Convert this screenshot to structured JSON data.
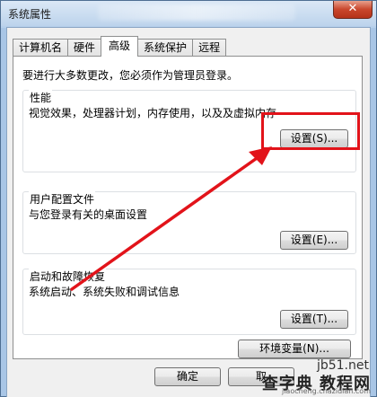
{
  "window": {
    "title": "系统属性",
    "close_label": "✕"
  },
  "tabs": [
    {
      "label": "计算机名",
      "active": false
    },
    {
      "label": "硬件",
      "active": false
    },
    {
      "label": "高级",
      "active": true
    },
    {
      "label": "系统保护",
      "active": false
    },
    {
      "label": "远程",
      "active": false
    }
  ],
  "panel": {
    "notice": "要进行大多数更改，您必须作为管理员登录。",
    "performance": {
      "title": "性能",
      "description": "视觉效果，处理器计划，内存使用，以及及虚拟内存",
      "button": "设置(S)..."
    },
    "user_profile": {
      "title": "用户配置文件",
      "description": "与您登录有关的桌面设置",
      "button": "设置(E)..."
    },
    "startup_recovery": {
      "title": "启动和故障恢复",
      "description": "系统启动、系统失败和调试信息",
      "button": "设置(T)..."
    },
    "env_button": "环境变量(N)..."
  },
  "footer": {
    "ok_button": "确定",
    "cancel_button": "取"
  },
  "watermark": {
    "site": "jb51.net",
    "big": "查字典 教程网",
    "url": "jiaocheng.chazidian.com"
  },
  "colors": {
    "highlight": "#e2131a",
    "arrow": "#e2131a"
  }
}
